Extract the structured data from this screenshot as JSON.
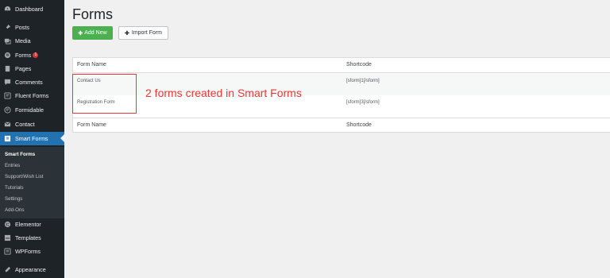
{
  "sidebar": {
    "menu": [
      {
        "label": "Dashboard",
        "icon": "dashboard-icon"
      },
      {
        "label": "Posts",
        "icon": "pin-icon"
      },
      {
        "label": "Media",
        "icon": "media-icon"
      },
      {
        "label": "Forms",
        "icon": "forms-icon",
        "badge": "1"
      },
      {
        "label": "Pages",
        "icon": "pages-icon"
      },
      {
        "label": "Comments",
        "icon": "comment-icon"
      },
      {
        "label": "Fluent Forms",
        "icon": "fluent-forms-icon"
      },
      {
        "label": "Formidable",
        "icon": "formidable-icon"
      },
      {
        "label": "Contact",
        "icon": "mail-icon"
      },
      {
        "label": "Smart Forms",
        "icon": "smart-forms-icon"
      },
      {
        "label": "Elementor",
        "icon": "elementor-icon"
      },
      {
        "label": "Templates",
        "icon": "templates-icon"
      },
      {
        "label": "WPForms",
        "icon": "wpforms-icon"
      },
      {
        "label": "Appearance",
        "icon": "appearance-icon"
      }
    ],
    "submenu": [
      "Smart Forms",
      "Entries",
      "Support/Wish List",
      "Tutorials",
      "Settings",
      "Add-Ons"
    ]
  },
  "main": {
    "title": "Forms",
    "add_new_label": "Add New",
    "import_label": "Import Form"
  },
  "table": {
    "header": {
      "name": "Form Name",
      "shortcode": "Shortcode"
    },
    "rows": [
      {
        "name": "Contact Us",
        "shortcode": "[sform]1[/sform]"
      },
      {
        "name": "Registration Form",
        "shortcode": "[sform]3[/sform]"
      }
    ],
    "footer": {
      "name": "Form Name",
      "shortcode": "Shortcode"
    }
  },
  "annotation": "2 forms created in Smart Forms",
  "colors": {
    "sidebar_bg": "#1d2327",
    "active_bg": "#2271b1",
    "add_button": "#4caf50",
    "annotation": "#e53935",
    "badge": "#d63638"
  }
}
